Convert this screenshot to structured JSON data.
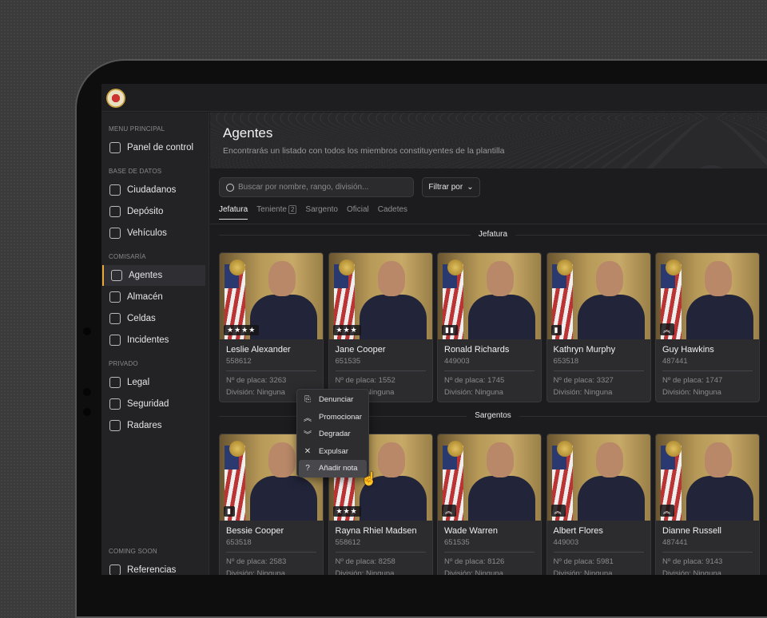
{
  "sidebar": {
    "sections": [
      "MENU PRINCIPAL",
      "BASE DE DATOS",
      "COMISARÍA",
      "PRIVADO",
      "COMING SOON"
    ],
    "items": [
      {
        "label": "Panel de control",
        "icon": "chart-icon"
      },
      {
        "label": "Ciudadanos",
        "icon": "users-icon"
      },
      {
        "label": "Depósito",
        "icon": "key-icon"
      },
      {
        "label": "Vehículos",
        "icon": "truck-icon"
      },
      {
        "label": "Agentes",
        "icon": "shield-icon",
        "active": true
      },
      {
        "label": "Almacén",
        "icon": "cart-icon"
      },
      {
        "label": "Celdas",
        "icon": "lock-icon"
      },
      {
        "label": "Incidentes",
        "icon": "file-search-icon"
      },
      {
        "label": "Legal",
        "icon": "scale-icon"
      },
      {
        "label": "Seguridad",
        "icon": "video-icon"
      },
      {
        "label": "Radares",
        "icon": "camera-icon"
      },
      {
        "label": "Referencias",
        "icon": "help-icon"
      }
    ]
  },
  "header": {
    "title": "Agentes",
    "subtitle": "Encontrarás un listado con todos los miembros constituyentes de la plantilla"
  },
  "search": {
    "placeholder": "Buscar por nombre, rango, división..."
  },
  "filter_label": "Filtrar por",
  "tabs": [
    {
      "label": "Jefatura"
    },
    {
      "label": "Teniente",
      "badge": "2"
    },
    {
      "label": "Sargento"
    },
    {
      "label": "Oficial"
    },
    {
      "label": "Cadetes"
    }
  ],
  "groups": [
    {
      "title": "Jefatura",
      "agents": [
        {
          "name": "Leslie Alexander",
          "id": "558612",
          "plate": "Nº de placa: 3263",
          "division": "División: Ninguna",
          "rank": "★★★★"
        },
        {
          "name": "Jane Cooper",
          "id": "651535",
          "plate": "Nº de placa: 1552",
          "division": "División: Ninguna",
          "rank": "★★★"
        },
        {
          "name": "Ronald Richards",
          "id": "449003",
          "plate": "Nº de placa: 1745",
          "division": "División: Ninguna",
          "rank": "▮▮"
        },
        {
          "name": "Kathryn Murphy",
          "id": "653518",
          "plate": "Nº de placa: 3327",
          "division": "División: Ninguna",
          "rank": "▮"
        },
        {
          "name": "Guy Hawkins",
          "id": "487441",
          "plate": "Nº de placa: 1747",
          "division": "División: Ninguna",
          "rank": "︽"
        }
      ]
    },
    {
      "title": "Sargentos",
      "agents": [
        {
          "name": "Bessie Cooper",
          "id": "653518",
          "plate": "Nº de placa: 2583",
          "division": "División: Ninguna",
          "rank": "▮"
        },
        {
          "name": "Rayna Rhiel Madsen",
          "id": "558612",
          "plate": "Nº de placa: 8258",
          "division": "División: Ninguna",
          "rank": "★★★"
        },
        {
          "name": "Wade Warren",
          "id": "651535",
          "plate": "Nº de placa: 8126",
          "division": "División: Ninguna",
          "rank": "︽"
        },
        {
          "name": "Albert Flores",
          "id": "449003",
          "plate": "Nº de placa: 5981",
          "division": "División: Ninguna",
          "rank": "︽"
        },
        {
          "name": "Dianne Russell",
          "id": "487441",
          "plate": "Nº de placa: 9143",
          "division": "División: Ninguna",
          "rank": "︽"
        }
      ]
    }
  ],
  "context_menu": [
    {
      "label": "Denunciar",
      "glyph": "⎘"
    },
    {
      "label": "Promocionar",
      "glyph": "︽"
    },
    {
      "label": "Degradar",
      "glyph": "︾"
    },
    {
      "label": "Expulsar",
      "glyph": "✕"
    },
    {
      "label": "Añadir nota",
      "glyph": "?"
    }
  ],
  "cursor_glyph": "☝"
}
